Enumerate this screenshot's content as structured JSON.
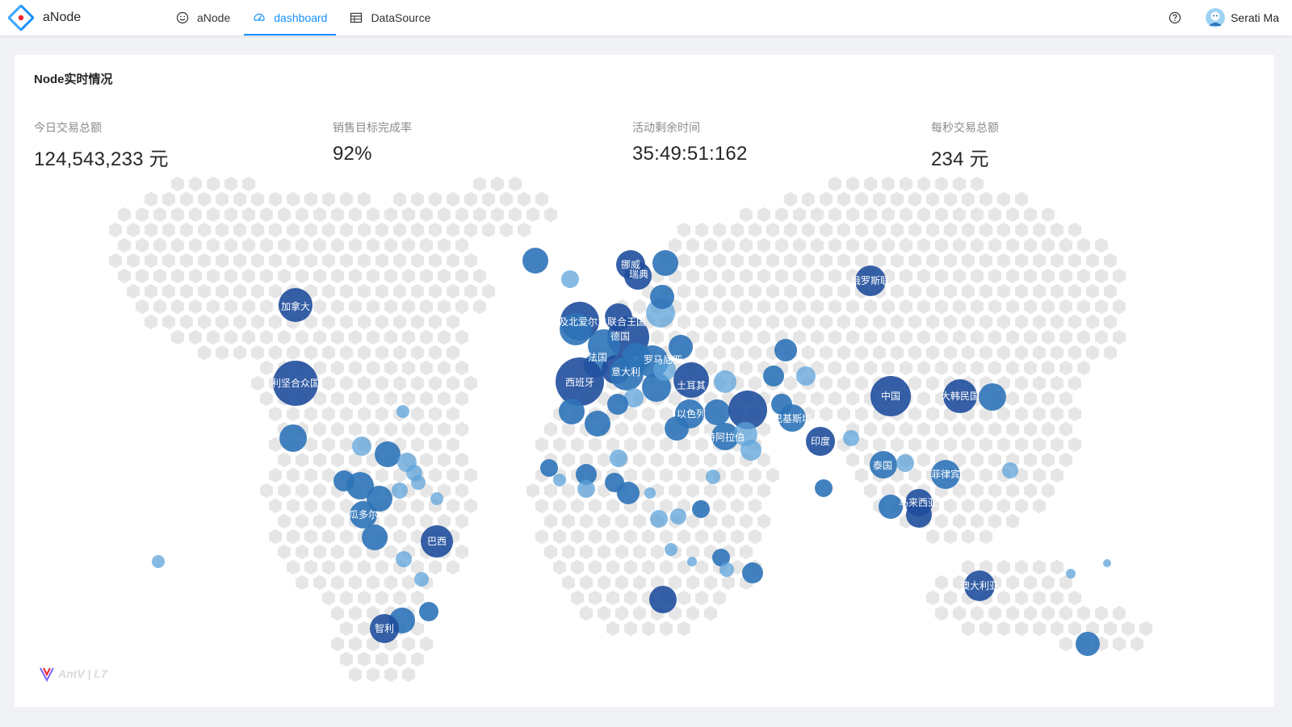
{
  "header": {
    "app_name": "aNode",
    "nav": [
      {
        "label": "aNode",
        "icon": "smile-icon",
        "active": false
      },
      {
        "label": "dashboard",
        "icon": "dashboard-icon",
        "active": true
      },
      {
        "label": "DataSource",
        "icon": "table-icon",
        "active": false
      }
    ],
    "help_icon": "question-circle-icon",
    "user_name": "Serati Ma"
  },
  "card": {
    "title": "Node实时情况",
    "stats": [
      {
        "label": "今日交易总额",
        "value": "124,543,233 元"
      },
      {
        "label": "销售目标完成率",
        "value": "92%"
      },
      {
        "label": "活动剩余时间",
        "value": "35:49:51:162"
      },
      {
        "label": "每秒交易总额",
        "value": "234 元"
      }
    ]
  },
  "map": {
    "labels": [
      "挪威",
      "瑞典",
      "俄罗斯联",
      "加拿大",
      "及北爱尔兰联合王国",
      "德国",
      "法国",
      "罗马尼亚",
      "意大利",
      "西班牙",
      "土耳其",
      "以色列",
      "巴基斯坦",
      "特阿拉伯",
      "印度",
      "中国",
      "大韩民国",
      "利坚合众国",
      "泰国",
      "菲律宾",
      "马来西亚",
      "瓜多尔",
      "巴西",
      "澳大利亚",
      "智利"
    ],
    "colors": {
      "dark": "#1f4e9c",
      "mid": "#2e73b8",
      "light": "#5ea3d9",
      "hex": "#e6e6e6"
    },
    "logo_text": "AntV | L7"
  }
}
